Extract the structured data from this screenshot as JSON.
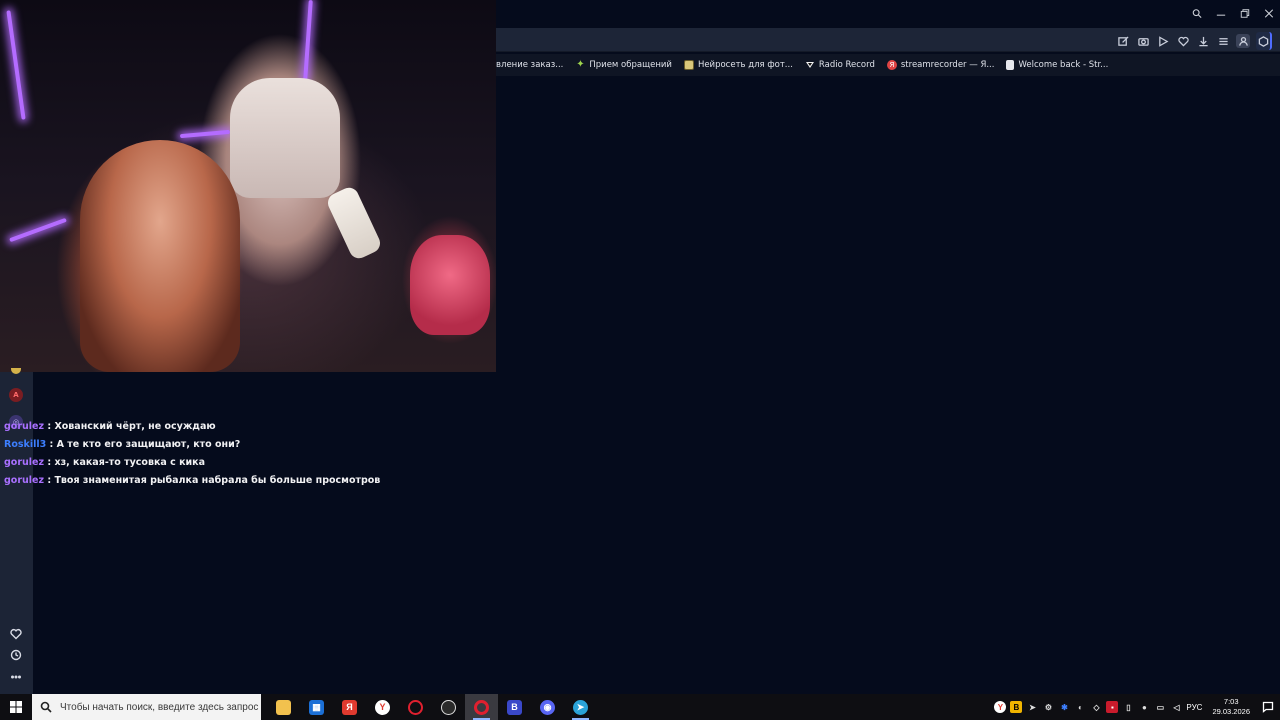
{
  "window": {
    "controls": [
      "search-icon",
      "minimize-icon",
      "restore-icon",
      "close-icon"
    ]
  },
  "bookmarks": [
    {
      "label": "вление заказ...",
      "icon": "bookmark-icon"
    },
    {
      "label": "Прием обращений",
      "icon": "leaf-icon"
    },
    {
      "label": "Нейросеть для фот...",
      "icon": "image-icon"
    },
    {
      "label": "Radio Record",
      "icon": "radio-icon"
    },
    {
      "label": "streamrecorder — Я...",
      "icon": "yandex-icon"
    },
    {
      "label": "Welcome back - Str...",
      "icon": "document-icon"
    }
  ],
  "chat": {
    "messages": [
      {
        "user": "gorulez",
        "sep": " : ",
        "text": "Хованский чёрт, не осуждаю",
        "color": "#a970ff"
      },
      {
        "user": "Roskill3",
        "sep": " : ",
        "text": "А те кто его защищают, кто они?",
        "color": "#3d7fff"
      },
      {
        "user": "gorulez",
        "sep": " : ",
        "text": "хз, какая-то тусовка с кика",
        "color": "#a970ff"
      },
      {
        "user": "gorulez",
        "sep": " : ",
        "text": "Твоя знаменитая рыбалка набрала бы больше просмотров",
        "color": "#a970ff"
      }
    ]
  },
  "taskbar": {
    "search_placeholder": "Чтобы начать поиск, введите здесь запрос",
    "language": "РУС",
    "time": "7:03",
    "date": "29.03.2026"
  }
}
